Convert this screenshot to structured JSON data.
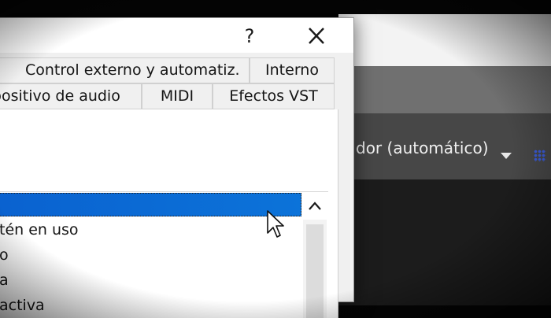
{
  "background_app": {
    "device_text": "dor (automático)",
    "dropdown_icon": "caret-down-icon",
    "grid_icon": "grid-icon",
    "accent_color": "#3a5bd8"
  },
  "dialog": {
    "help_label": "?",
    "close_icon": "close-icon",
    "tabs_row1": {
      "control": "Control externo y automatiz.",
      "interno": "Interno"
    },
    "tabs_row2": {
      "dispositivo": "spositivo de audio",
      "midi": "MIDI",
      "vst": "Efectos VST"
    },
    "list": {
      "items": [
        "",
        "tén en uso",
        "o",
        "a",
        "activa"
      ],
      "selected_index": 0,
      "selection_color": "#0c73d9"
    },
    "scroll_up_icon": "chevron-up-icon"
  }
}
